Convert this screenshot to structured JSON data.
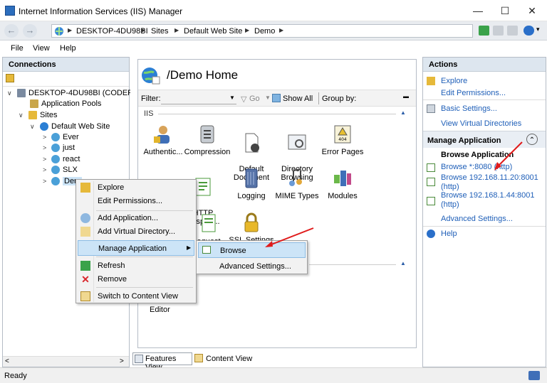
{
  "window": {
    "title": "Internet Information Services (IIS) Manager",
    "minimize": "—",
    "maximize": "☐",
    "close": "✕"
  },
  "address": {
    "back": "←",
    "forward": "→",
    "crumbs": [
      "DESKTOP-4DU98BI",
      "Sites",
      "Default Web Site",
      "Demo"
    ],
    "separator": "▶"
  },
  "menu": {
    "items": [
      "File",
      "View",
      "Help"
    ]
  },
  "connections": {
    "header": "Connections",
    "tree": [
      {
        "label": "DESKTOP-4DU98BI (CODERSIC",
        "expander": "∨",
        "icon": "server-icon"
      },
      {
        "label": "Application Pools",
        "expander": "",
        "icon": "app-pools-icon"
      },
      {
        "label": "Sites",
        "expander": "∨",
        "icon": "sites-folder-icon"
      },
      {
        "label": "Default Web Site",
        "expander": "∨",
        "icon": "globe-icon"
      },
      {
        "label": "Ever",
        "expander": ">",
        "icon": "web-app-icon"
      },
      {
        "label": "just",
        "expander": ">",
        "icon": "web-app-icon"
      },
      {
        "label": "react",
        "expander": ">",
        "icon": "web-app-icon"
      },
      {
        "label": "SLX",
        "expander": ">",
        "icon": "web-app-icon"
      },
      {
        "label": "Dem",
        "expander": ">",
        "icon": "web-app-icon"
      }
    ],
    "scroll_left": "<",
    "scroll_right": ">"
  },
  "home": {
    "title": "/Demo Home",
    "filter_label": "Filter:",
    "go_label": "Go",
    "show_all_label": "Show All",
    "group_by_label": "Group by:",
    "section_label": "IIS",
    "features_row1": [
      {
        "label": "Authentic...",
        "icon": "authentication-icon"
      },
      {
        "label": "Compression",
        "icon": "compression-icon"
      },
      {
        "label": "Default\nDocument",
        "icon": "default-document-icon"
      },
      {
        "label": "Directory\nBrowsing",
        "icon": "directory-browsing-icon"
      },
      {
        "label": "Error Pages",
        "icon": "error-pages-icon"
      }
    ],
    "features_row2": [
      {
        "label": "HTTP\nRespon...",
        "icon": "http-response-icon"
      },
      {
        "label": "Logging",
        "icon": "logging-icon"
      },
      {
        "label": "MIME Types",
        "icon": "mime-types-icon"
      },
      {
        "label": "Modules",
        "icon": "modules-icon"
      }
    ],
    "partial_request": "equest",
    "ssl_settings": "SSL Settings",
    "editor_label": "Editor",
    "error_icon_text": "404",
    "collapse": "▲"
  },
  "tabs": {
    "features_view": "Features View",
    "content_view": "Content View"
  },
  "actions": {
    "header": "Actions",
    "explore": "Explore",
    "edit_permissions": "Edit Permissions...",
    "basic_settings": "Basic Settings...",
    "view_virtual_dirs": "View Virtual Directories",
    "manage_application": "Manage Application",
    "browse_application": "Browse Application",
    "browse_8080": "Browse *:8080 (http)",
    "browse_ip1": "Browse 192.168.11.20:8001\n(http)",
    "browse_ip2": "Browse 192.168.1.44:8001\n(http)",
    "advanced_settings": "Advanced Settings...",
    "help": "Help",
    "collapse": "⌃"
  },
  "context_menu": {
    "items": [
      {
        "label": "Explore",
        "icon": "explore-icon"
      },
      {
        "label": "Edit Permissions...",
        "icon": ""
      },
      {
        "label": "Add Application...",
        "icon": "add-application-icon"
      },
      {
        "label": "Add Virtual Directory...",
        "icon": "add-virtual-directory-icon"
      },
      {
        "label": "Manage Application",
        "icon": "",
        "submenu": "▶"
      },
      {
        "label": "Refresh",
        "icon": "refresh-icon"
      },
      {
        "label": "Remove",
        "icon": "remove-icon"
      },
      {
        "label": "Switch to Content View",
        "icon": "content-view-icon"
      }
    ]
  },
  "submenu": {
    "browse": "Browse",
    "advanced_settings": "Advanced Settings..."
  },
  "status": {
    "text": "Ready"
  },
  "colors": {
    "link": "#1f5fb8",
    "panel_header": "#dde6ef",
    "highlight": "#cce4f7",
    "arrow": "#e01b1b"
  }
}
